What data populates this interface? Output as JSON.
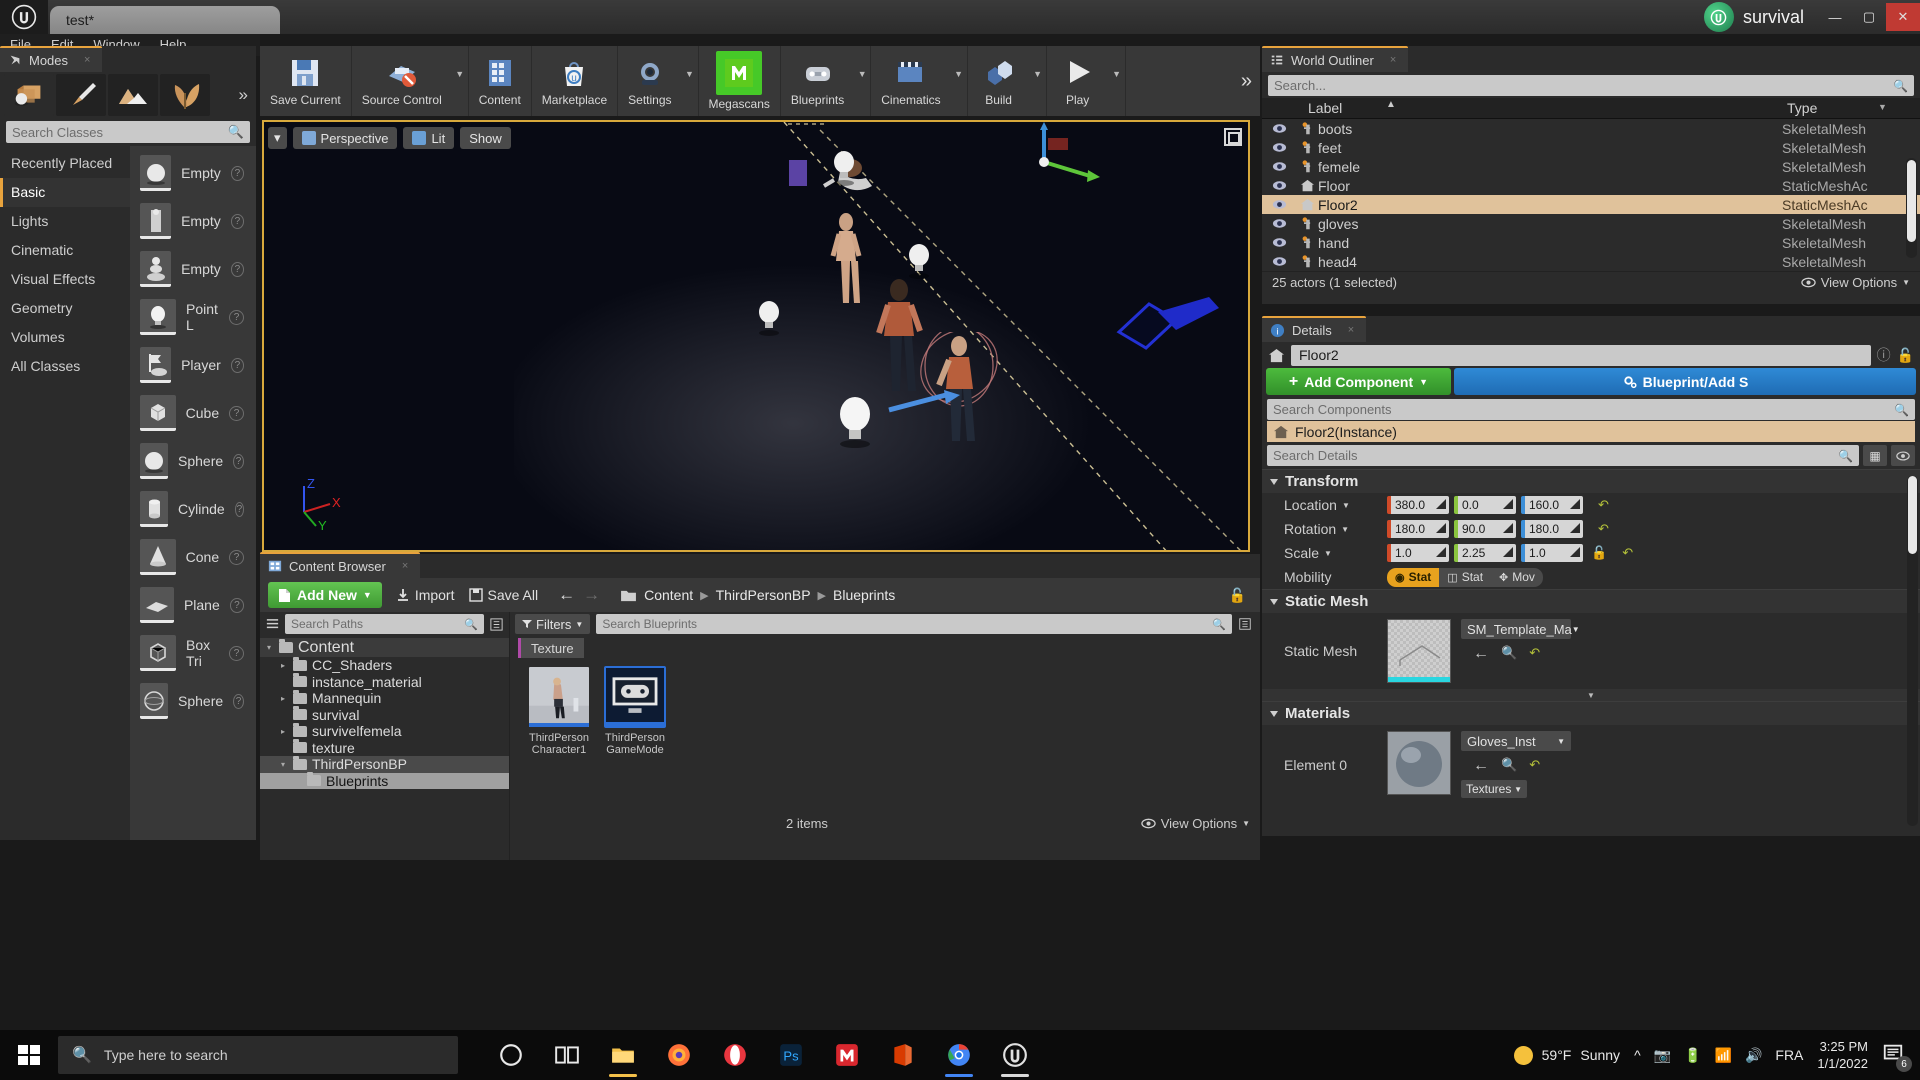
{
  "titlebar": {
    "project_tab": "test*",
    "project_name": "survival",
    "minimize": "—",
    "maximize": "▢",
    "close": "✕"
  },
  "menubar": {
    "items": [
      "File",
      "Edit",
      "Window",
      "Help"
    ]
  },
  "modes": {
    "tab_label": "Modes",
    "mode_icons": [
      "place-mode-icon",
      "paint-mode-icon",
      "landscape-mode-icon",
      "foliage-mode-icon"
    ],
    "more_label": "»",
    "search_placeholder": "Search Classes",
    "categories": [
      "Recently Placed",
      "Basic",
      "Lights",
      "Cinematic",
      "Visual Effects",
      "Geometry",
      "Volumes",
      "All Classes"
    ],
    "active_category": "Basic",
    "placeables": [
      {
        "name": "Empty",
        "icon": "sphere-thumb"
      },
      {
        "name": "Empty",
        "icon": "character-thumb"
      },
      {
        "name": "Empty",
        "icon": "pawn-thumb"
      },
      {
        "name": "Point L",
        "icon": "pointlight-thumb"
      },
      {
        "name": "Player",
        "icon": "playerstart-thumb"
      },
      {
        "name": "Cube",
        "icon": "cube-thumb"
      },
      {
        "name": "Sphere",
        "icon": "sphere-thumb"
      },
      {
        "name": "Cylinde",
        "icon": "cylinder-thumb"
      },
      {
        "name": "Cone",
        "icon": "cone-thumb"
      },
      {
        "name": "Plane",
        "icon": "plane-thumb"
      },
      {
        "name": "Box Tri",
        "icon": "boxtrigger-thumb"
      },
      {
        "name": "Sphere",
        "icon": "spheretrigger-thumb"
      }
    ]
  },
  "toolbar": {
    "buttons": [
      {
        "label": "Save Current",
        "icon": "save-icon",
        "dropdown": false
      },
      {
        "label": "Source Control",
        "icon": "source-control-icon",
        "dropdown": true
      },
      {
        "label": "Content",
        "icon": "content-icon",
        "dropdown": false
      },
      {
        "label": "Marketplace",
        "icon": "marketplace-icon",
        "dropdown": false
      },
      {
        "label": "Settings",
        "icon": "settings-icon",
        "dropdown": true
      },
      {
        "label": "Megascans",
        "icon": "megascans-icon",
        "dropdown": false
      },
      {
        "label": "Blueprints",
        "icon": "blueprints-icon",
        "dropdown": true
      },
      {
        "label": "Cinematics",
        "icon": "cinematics-icon",
        "dropdown": true
      },
      {
        "label": "Build",
        "icon": "build-icon",
        "dropdown": true
      },
      {
        "label": "Play",
        "icon": "play-icon",
        "dropdown": true
      }
    ],
    "overflow": "»"
  },
  "viewport": {
    "perspective": "Perspective",
    "lit": "Lit",
    "show": "Show",
    "axes": {
      "x": "X",
      "y": "Y",
      "z": "Z"
    }
  },
  "content_browser": {
    "tab_label": "Content Browser",
    "add_new": "Add New",
    "import": "Import",
    "save_all": "Save All",
    "breadcrumb": [
      "Content",
      "ThirdPersonBP",
      "Blueprints"
    ],
    "paths_placeholder": "Search Paths",
    "filters_label": "Filters",
    "assets_placeholder": "Search Blueprints",
    "filter_chip": "Texture",
    "tree": [
      {
        "label": "Content",
        "depth": 0,
        "caret": "open",
        "state": "root"
      },
      {
        "label": "CC_Shaders",
        "depth": 1,
        "caret": "closed",
        "state": ""
      },
      {
        "label": "instance_material",
        "depth": 1,
        "caret": "none",
        "state": ""
      },
      {
        "label": "Mannequin",
        "depth": 1,
        "caret": "closed",
        "state": ""
      },
      {
        "label": "survival",
        "depth": 1,
        "caret": "none",
        "state": ""
      },
      {
        "label": "survivelfemela",
        "depth": 1,
        "caret": "closed",
        "state": ""
      },
      {
        "label": "texture",
        "depth": 1,
        "caret": "none",
        "state": ""
      },
      {
        "label": "ThirdPersonBP",
        "depth": 1,
        "caret": "open",
        "state": "semi"
      },
      {
        "label": "Blueprints",
        "depth": 2,
        "caret": "none",
        "state": "sel"
      }
    ],
    "assets": [
      {
        "name": "ThirdPerson Character1",
        "selected": false,
        "icon": "character-asset"
      },
      {
        "name": "ThirdPerson GameMode",
        "selected": true,
        "icon": "gamemode-asset"
      }
    ],
    "item_count": "2 items",
    "view_options": "View Options"
  },
  "outliner": {
    "tab_label": "World Outliner",
    "search_placeholder": "Search...",
    "columns": [
      "Label",
      "Type"
    ],
    "rows": [
      {
        "label": "boots",
        "type": "SkeletalMesh",
        "icon": "skeletal-mesh-icon",
        "selected": false
      },
      {
        "label": "feet",
        "type": "SkeletalMesh",
        "icon": "skeletal-mesh-icon",
        "selected": false
      },
      {
        "label": "femele",
        "type": "SkeletalMesh",
        "icon": "skeletal-mesh-icon",
        "selected": false
      },
      {
        "label": "Floor",
        "type": "StaticMeshAc",
        "icon": "static-mesh-icon",
        "selected": false
      },
      {
        "label": "Floor2",
        "type": "StaticMeshAc",
        "icon": "static-mesh-icon",
        "selected": true
      },
      {
        "label": "gloves",
        "type": "SkeletalMesh",
        "icon": "skeletal-mesh-icon",
        "selected": false
      },
      {
        "label": "hand",
        "type": "SkeletalMesh",
        "icon": "skeletal-mesh-icon",
        "selected": false
      },
      {
        "label": "head4",
        "type": "SkeletalMesh",
        "icon": "skeletal-mesh-icon",
        "selected": false
      }
    ],
    "status": "25 actors (1 selected)",
    "view_options": "View Options"
  },
  "details": {
    "tab_label": "Details",
    "actor_name": "Floor2",
    "add_component": "Add Component",
    "blueprint_button": "Blueprint/Add S",
    "search_components_placeholder": "Search Components",
    "component_item": "Floor2(Instance)",
    "search_details_placeholder": "Search Details",
    "transform": {
      "header": "Transform",
      "rows": [
        {
          "label": "Location",
          "x": "380.0",
          "y": "0.0",
          "z": "160.0"
        },
        {
          "label": "Rotation",
          "x": "180.0",
          "y": "90.0",
          "z": "180.0"
        },
        {
          "label": "Scale",
          "x": "1.0",
          "y": "2.25",
          "z": "1.0"
        }
      ],
      "mobility_label": "Mobility",
      "mobility_options": [
        "Stat",
        "Stat",
        "Mov"
      ],
      "mobility_selected": 0
    },
    "static_mesh": {
      "header": "Static Mesh",
      "label": "Static Mesh",
      "asset": "SM_Template_Ma"
    },
    "materials": {
      "header": "Materials",
      "label": "Element 0",
      "asset": "Gloves_Inst",
      "sub_asset": "Textures"
    }
  },
  "taskbar": {
    "search_placeholder": "Type here to search",
    "apps": [
      {
        "name": "cortana-icon",
        "color": "#ffffff"
      },
      {
        "name": "taskview-icon",
        "color": "#ffffff"
      },
      {
        "name": "explorer-icon",
        "color": "#f3c04a"
      },
      {
        "name": "firefox-icon",
        "color": "#ff7139"
      },
      {
        "name": "opera-icon",
        "color": "#e8363f"
      },
      {
        "name": "photoshop-icon",
        "color": "#31a8ff"
      },
      {
        "name": "mega-icon",
        "color": "#d9272e"
      },
      {
        "name": "office-icon",
        "color": "#d83b01"
      },
      {
        "name": "chrome-icon",
        "color": "#4285f4"
      },
      {
        "name": "unreal-icon",
        "color": "#d8d8d8"
      }
    ],
    "weather_temp": "59°F",
    "weather_desc": "Sunny",
    "language": "FRA",
    "time": "3:25 PM",
    "date": "1/1/2022",
    "notification_count": "6"
  },
  "colors": {
    "accent_orange": "#e8a33d",
    "selection_tan": "#e0c29b",
    "green_button": "#4dbb3d",
    "blue_button": "#2f8ad6",
    "axis_x": "#d04a28",
    "axis_y": "#8bc53f",
    "axis_z": "#3d8fd8"
  }
}
